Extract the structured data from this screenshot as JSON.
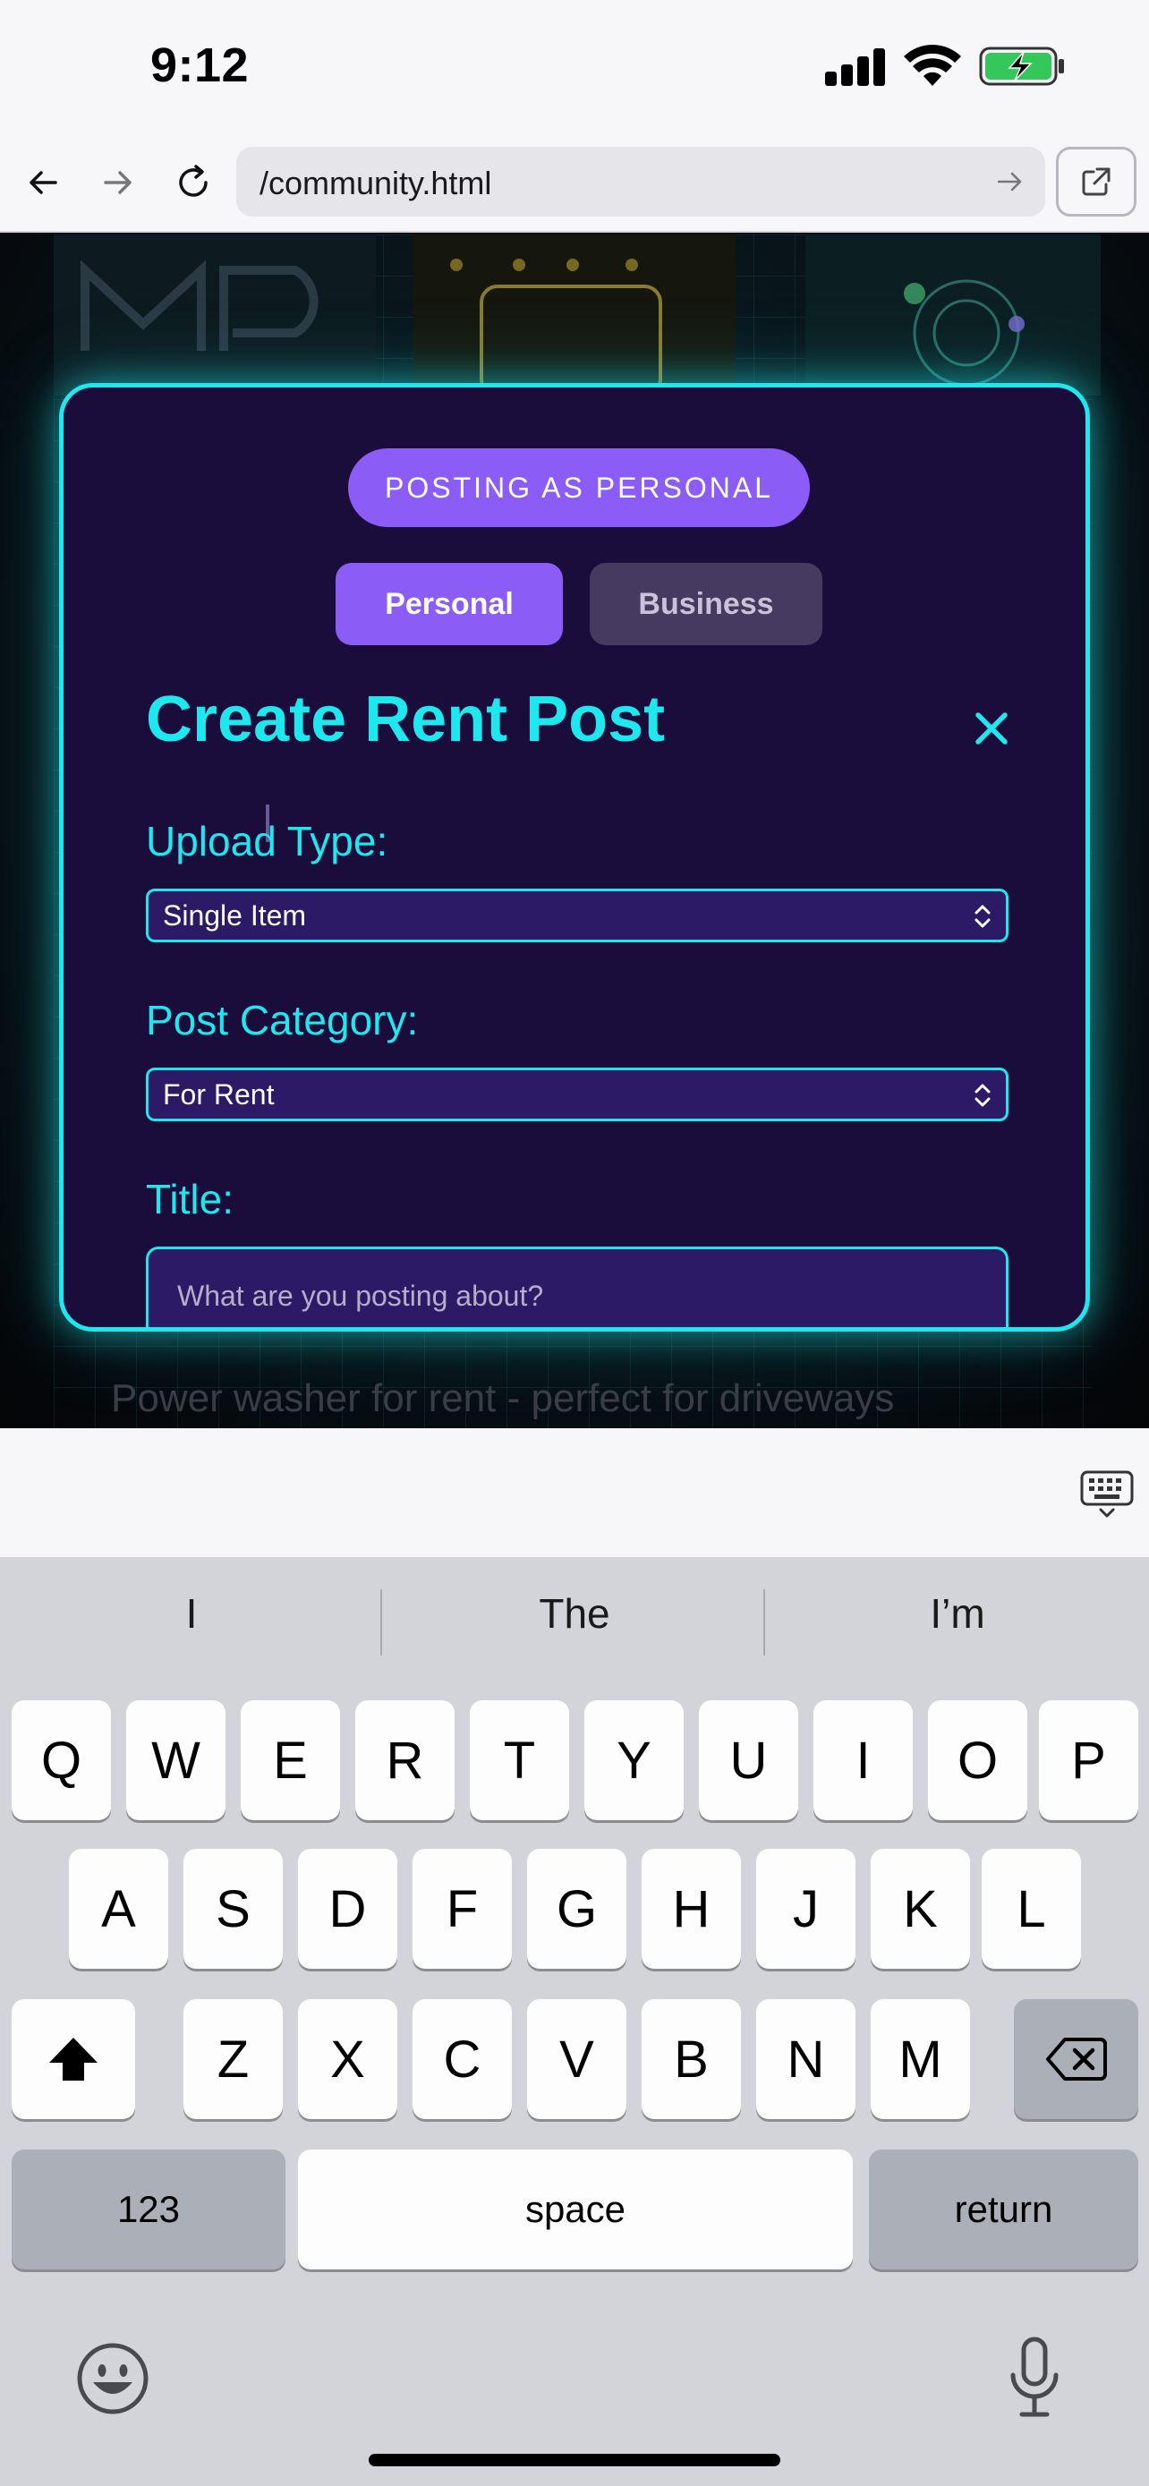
{
  "status_bar": {
    "time": "9:12"
  },
  "browser": {
    "url": "/community.html"
  },
  "page": {
    "background_caption": "Power washer for rent - perfect for driveways"
  },
  "modal": {
    "posting_as": "POSTING AS PERSONAL",
    "toggle_personal": "Personal",
    "toggle_business": "Business",
    "title": "Create Rent Post",
    "upload_type_label": "Upload Type:",
    "upload_type_value": "Single Item",
    "post_category_label": "Post Category:",
    "post_category_value": "For Rent",
    "title_label": "Title:",
    "title_placeholder": "What are you posting about?"
  },
  "keyboard": {
    "suggestions": [
      "I",
      "The",
      "I’m"
    ],
    "row1": [
      "Q",
      "W",
      "E",
      "R",
      "T",
      "Y",
      "U",
      "I",
      "O",
      "P"
    ],
    "row2": [
      "A",
      "S",
      "D",
      "F",
      "G",
      "H",
      "J",
      "K",
      "L"
    ],
    "row3": [
      "Z",
      "X",
      "C",
      "V",
      "B",
      "N",
      "M"
    ],
    "numbers_key": "123",
    "space_key": "space",
    "return_key": "return"
  },
  "colors": {
    "accent_cyan": "#1ee8ee",
    "accent_purple": "#8b5cf6",
    "modal_bg": "#1a0c3b",
    "input_bg": "#2c1a66"
  },
  "icons": [
    "back-arrow-icon",
    "forward-arrow-icon",
    "reload-icon",
    "open-external-icon",
    "close-icon",
    "keyboard-dismiss-icon",
    "shift-icon",
    "delete-icon",
    "emoji-icon",
    "microphone-icon"
  ]
}
